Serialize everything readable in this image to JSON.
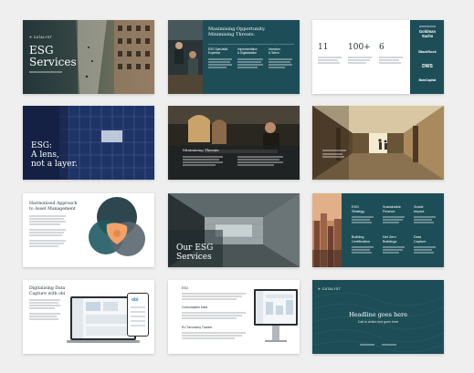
{
  "s1": {
    "brand": "CATALYST",
    "title_line1": "ESG",
    "title_line2": "Services"
  },
  "s2": {
    "title_line1": "Maximising Opportunity.",
    "title_line2": "Minimising Threats.",
    "cols": [
      {
        "head_line1": "ESG Specialist",
        "head_line2": "Expertise"
      },
      {
        "head_line1": "Implementation",
        "head_line2": "& Digitalisation"
      },
      {
        "head_line1": "Investors",
        "head_line2": "& Talent"
      }
    ]
  },
  "s3": {
    "stats": [
      "11",
      "100+",
      "6"
    ],
    "logos": [
      "Goldman Sachs",
      "BlackRock",
      "DWS",
      "BainCapital"
    ]
  },
  "s4": {
    "title_line1": "ESG:",
    "title_line2": "A lens,",
    "title_line3": "not a layer."
  },
  "s5": {
    "caption": "Minimising Threats"
  },
  "s7": {
    "title_line1": "Harmonised Approach",
    "title_line2": "to Asset Management"
  },
  "s8": {
    "title_line1": "Our ESG",
    "title_line2": "Services"
  },
  "s9": {
    "items": [
      {
        "line1": "ESG",
        "line2": "Strategy"
      },
      {
        "line1": "Sustainable",
        "line2": "Finance"
      },
      {
        "line1": "Social",
        "line2": "Impact"
      },
      {
        "line1": "Building",
        "line2": "Certification"
      },
      {
        "line1": "Net Zero",
        "line2": "Buildings"
      },
      {
        "line1": "Data",
        "line2": "Capture"
      }
    ]
  },
  "s10": {
    "title_line1": "Digitalising Data",
    "title_line2": "Capture with obi",
    "app_logo": "obi"
  },
  "s11": {
    "items": [
      "ESG",
      "Consumption Data",
      "EU Taxonomy Tracker"
    ]
  },
  "s12": {
    "brand": "CATALYST",
    "headline": "Headline goes here",
    "subline": "Call to action text goes here"
  }
}
